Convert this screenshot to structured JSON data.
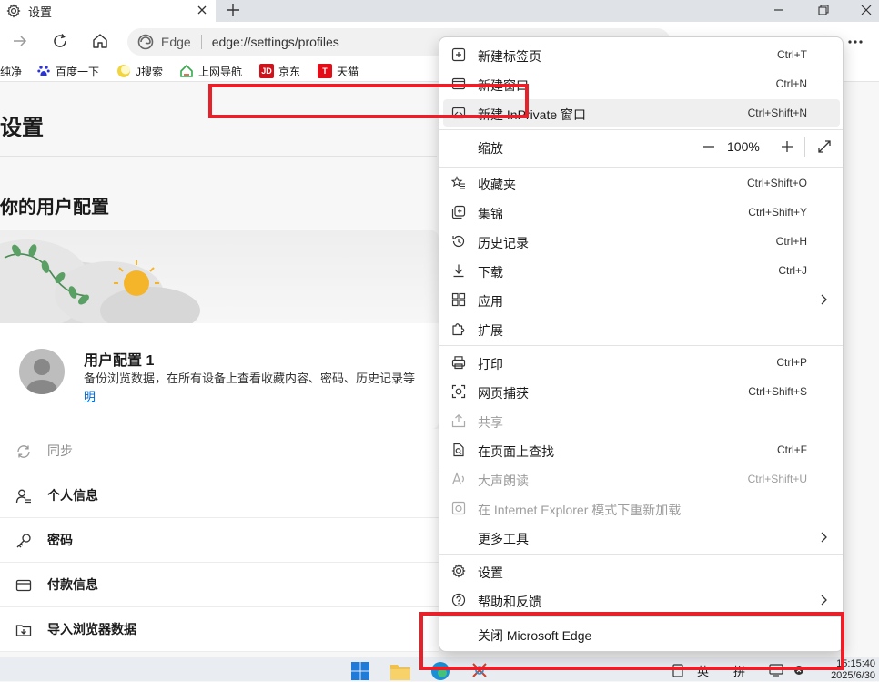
{
  "tab": {
    "title": "设置"
  },
  "address": {
    "browser_label": "Edge",
    "url": "edge://settings/profiles"
  },
  "favorites": [
    {
      "label": "纯净",
      "color": "#444444"
    },
    {
      "label": "百度一下",
      "color": "#2b32d8"
    },
    {
      "label": "J搜索",
      "color": "#f2d340"
    },
    {
      "label": "上网导航",
      "color": "#35a84c"
    },
    {
      "label": "京东",
      "color": "#d0131b"
    },
    {
      "label": "天猫",
      "color": "#e30c17"
    }
  ],
  "page": {
    "title": "设置",
    "profiles_title": "你的用户配置",
    "profile_name": "用户配置 1",
    "profile_desc": "备份浏览数据，在所有设备上查看收藏内容、密码、历史记录等",
    "profile_link": "明",
    "rows": [
      {
        "label": "同步",
        "icon": "sync-icon",
        "disabled": true
      },
      {
        "label": "个人信息",
        "icon": "person-icon",
        "disabled": false
      },
      {
        "label": "密码",
        "icon": "key-icon",
        "disabled": false
      },
      {
        "label": "付款信息",
        "icon": "card-icon",
        "disabled": false
      },
      {
        "label": "导入浏览器数据",
        "icon": "import-icon",
        "disabled": false
      }
    ]
  },
  "menu": {
    "new_tab": {
      "label": "新建标签页",
      "shortcut": "Ctrl+T"
    },
    "new_window": {
      "label": "新建窗口",
      "shortcut": "Ctrl+N"
    },
    "new_inprivate": {
      "label": "新建 InPrivate 窗口",
      "shortcut": "Ctrl+Shift+N"
    },
    "zoom": {
      "label": "缩放",
      "minus": "—",
      "value": "100%",
      "plus": "+"
    },
    "favorites": {
      "label": "收藏夹",
      "shortcut": "Ctrl+Shift+O"
    },
    "collections": {
      "label": "集锦",
      "shortcut": "Ctrl+Shift+Y"
    },
    "history": {
      "label": "历史记录",
      "shortcut": "Ctrl+H"
    },
    "downloads": {
      "label": "下载",
      "shortcut": "Ctrl+J"
    },
    "apps": {
      "label": "应用"
    },
    "extensions": {
      "label": "扩展"
    },
    "print": {
      "label": "打印",
      "shortcut": "Ctrl+P"
    },
    "web_capture": {
      "label": "网页捕获",
      "shortcut": "Ctrl+Shift+S"
    },
    "share": {
      "label": "共享"
    },
    "find": {
      "label": "在页面上查找",
      "shortcut": "Ctrl+F"
    },
    "read_aloud": {
      "label": "大声朗读",
      "shortcut": "Ctrl+Shift+U"
    },
    "ie_mode": {
      "label": "在 Internet Explorer 模式下重新加载"
    },
    "more_tools": {
      "label": "更多工具"
    },
    "settings": {
      "label": "设置"
    },
    "help": {
      "label": "帮助和反馈"
    },
    "close_edge": {
      "label": "关闭 Microsoft Edge"
    }
  },
  "taskbar": {
    "ime_lang": "英",
    "ime_mode": "拼",
    "time": "15:15:40",
    "date": "2025/6/30"
  },
  "colors": {
    "annotation": "#e8202a",
    "link": "#0066cc",
    "accent": "#0f6cbd"
  }
}
